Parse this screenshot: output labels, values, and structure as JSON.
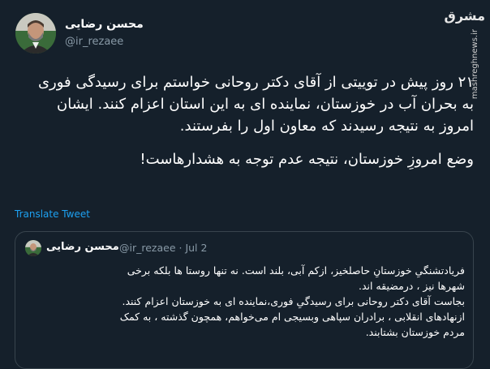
{
  "author": {
    "name": "محسن رضایی",
    "handle": "@ir_rezaee"
  },
  "watermark": {
    "logo": "مشرق",
    "url": "mashreghnews.ir"
  },
  "tweet": {
    "paragraphs": [
      "۲۱ روز پیش در توییتی از آقای دکتر روحانی خواستم برای رسیدگی فوری به بحران آب در خوزستان، نماینده ای به این استان اعزام کنند. ایشان امروز به نتیجه رسیدند که معاون اول را بفرستند.",
      "وضع امروزِ خوزستان، نتیجه عدم توجه به هشدارهاست!"
    ],
    "translate_label": "Translate Tweet"
  },
  "quoted_tweet": {
    "name": "محسن رضایی",
    "handle_date": "@ir_rezaee · Jul 2",
    "lines": [
      "فریادتشنگیِ خوزستانِ حاصلخیز، ازکم آبی، بلند است. نه تنها روستا ها بلکه برخی",
      "شهرها نیز ، درمضیقه اند.",
      "بجاست آقای دکتر روحانی برای رسیدگیِ فوری،نماینده ای به خوزستان اعزام کنند.",
      "ازنهادهای انقلابی ، برادران سپاهی وبسیجی ام می‌خواهم، همچون گذشته ، به کمک",
      "مردم خوزستان  بشتابند."
    ]
  }
}
